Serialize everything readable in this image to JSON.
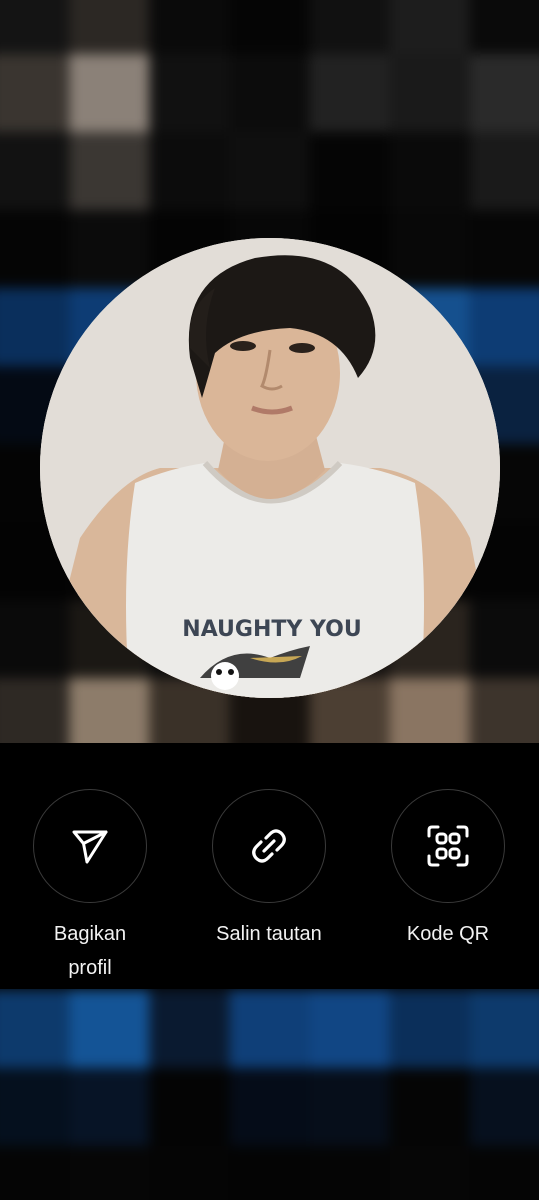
{
  "share_actions": [
    {
      "label": "Bagikan\nprofil",
      "icon": "send-icon"
    },
    {
      "label": "Salin tautan",
      "icon": "link-icon"
    },
    {
      "label": "Kode QR",
      "icon": "qr-scan-icon"
    }
  ],
  "avatar": {
    "shirt_text": "NAUGHTY YOU"
  },
  "colors": {
    "background": "#000000",
    "accent_blue": "#1a6fd8",
    "icon": "#ffffff",
    "label": "#f2f2f2",
    "circle_border": "#3a3a3a"
  }
}
